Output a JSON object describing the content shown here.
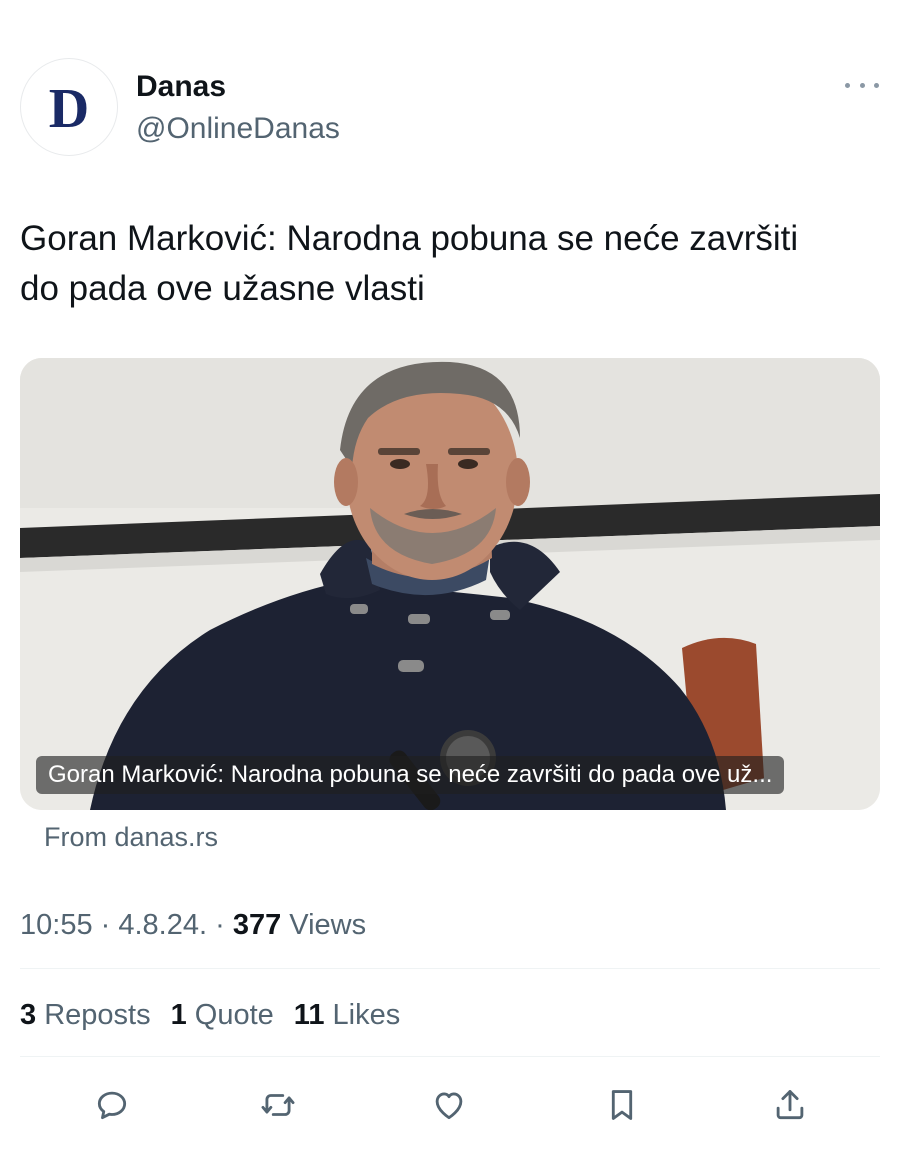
{
  "tweet": {
    "avatar_letter": "D",
    "display_name": "Danas",
    "handle": "@OnlineDanas",
    "text_line1": "Goran Marković: Narodna pobuna se neće završiti",
    "text_line2": "do pada ove užasne vlasti",
    "card_caption": "Goran Marković: Narodna pobuna se neće završiti do pada ove už...",
    "source": "From danas.rs",
    "time": "10:55",
    "date": "4.8.24.",
    "views_count": "377",
    "views_label": "Views",
    "reposts_count": "3",
    "reposts_label": "Reposts",
    "quotes_count": "1",
    "quotes_label": "Quote",
    "likes_count": "11",
    "likes_label": "Likes"
  },
  "icons": {
    "more": "more-dots-icon",
    "reply": "reply-bubble-icon",
    "repost": "repost-arrows-icon",
    "like": "heart-icon",
    "bookmark": "bookmark-icon",
    "share": "share-upload-icon"
  },
  "colors": {
    "text": "#0f1419",
    "secondary": "#536471",
    "divider": "#eff3f4",
    "brand_letter": "#1a2a66"
  }
}
